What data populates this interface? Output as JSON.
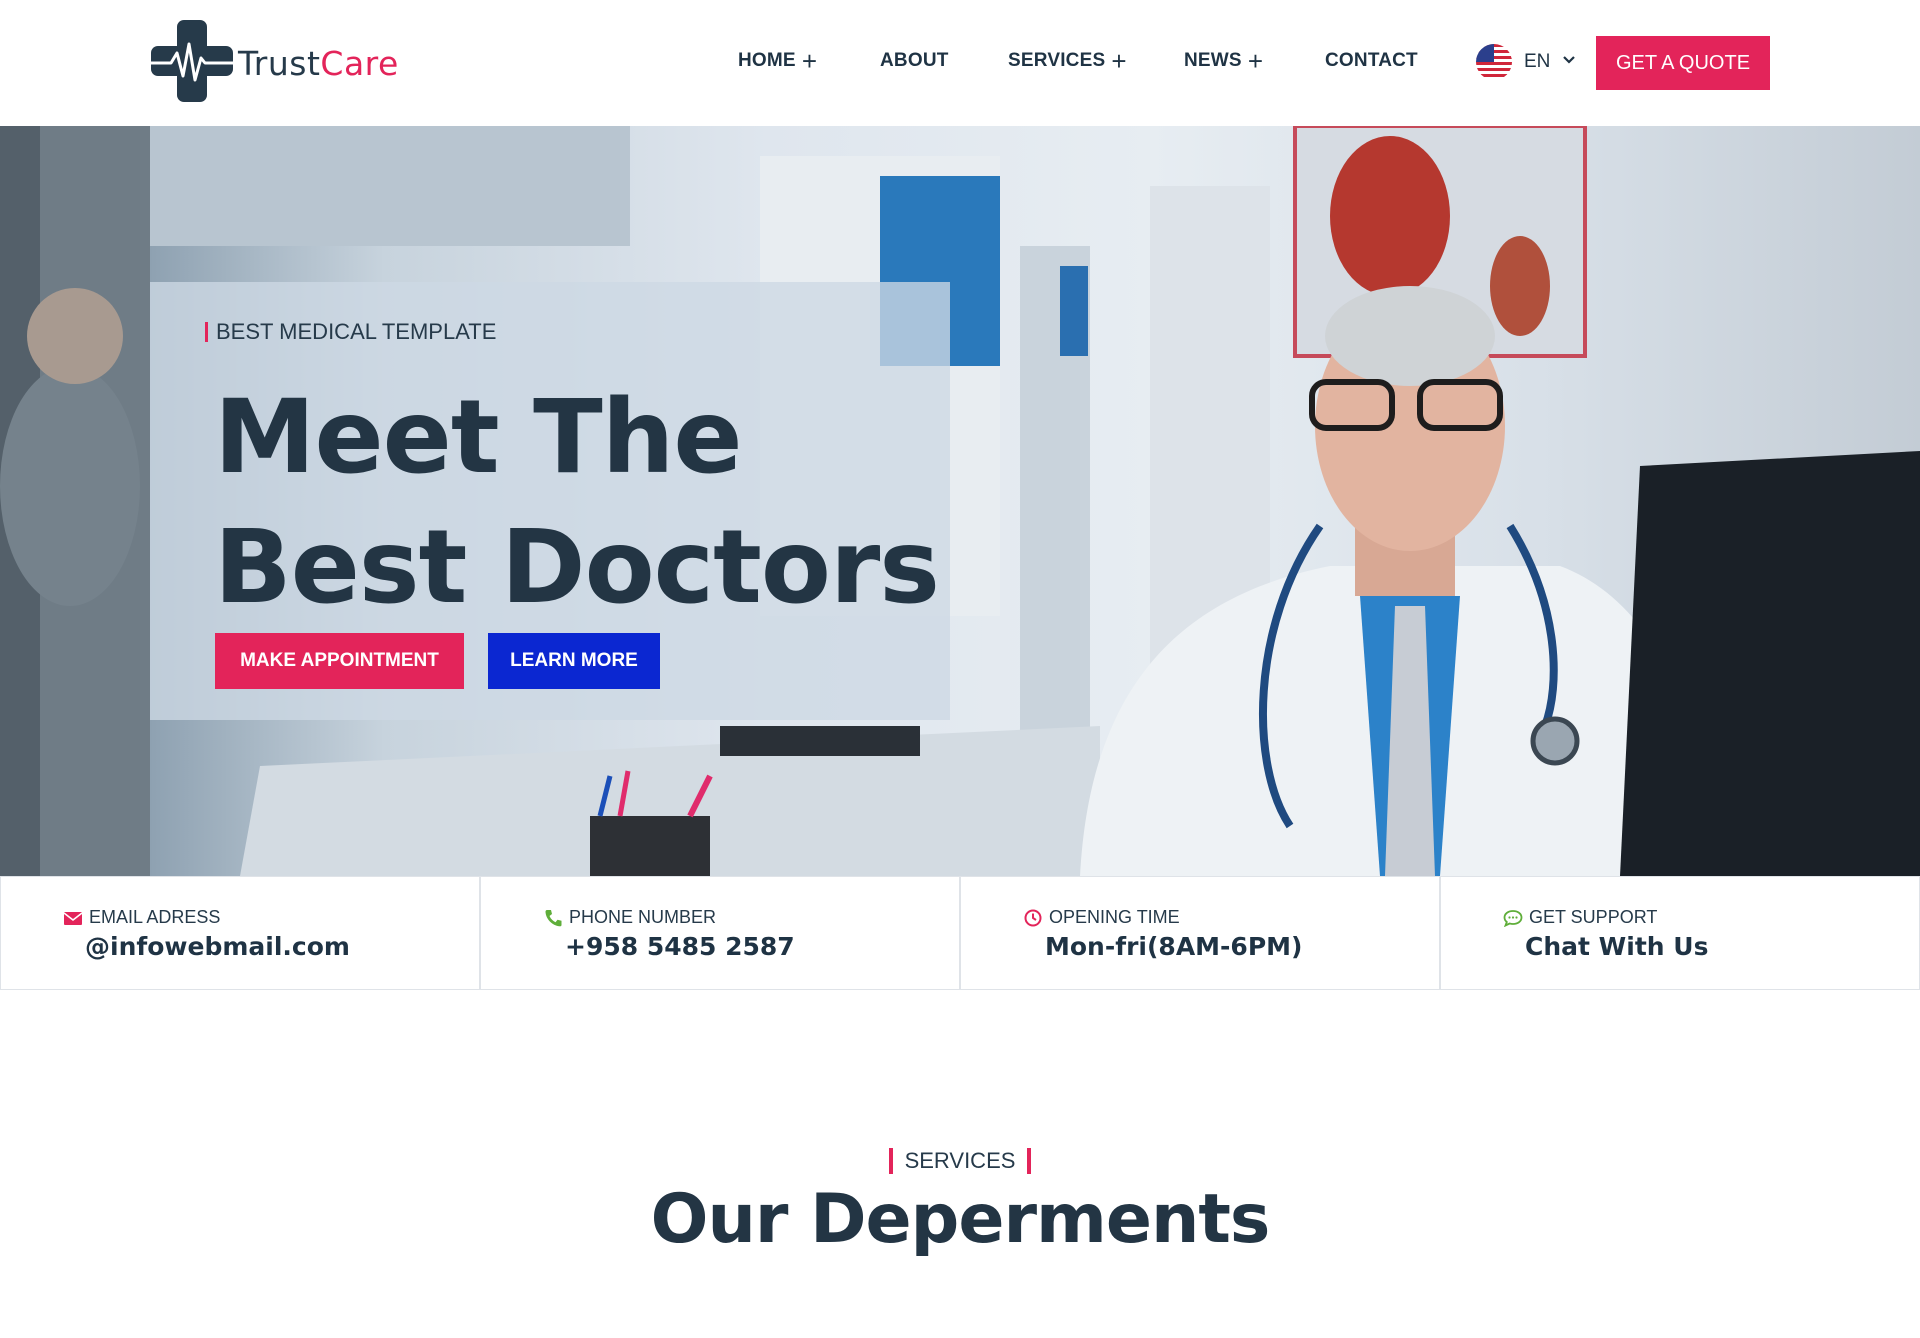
{
  "brand": {
    "name_part1": "Trust",
    "name_part2": "Care",
    "logo_icon": "medical-cross-heartbeat-icon"
  },
  "nav": {
    "items": [
      {
        "label": "HOME",
        "has_submenu": true
      },
      {
        "label": "ABOUT",
        "has_submenu": false
      },
      {
        "label": "SERVICES",
        "has_submenu": true
      },
      {
        "label": "NEWS",
        "has_submenu": true
      },
      {
        "label": "CONTACT",
        "has_submenu": false
      }
    ],
    "plus_glyph": "+"
  },
  "language": {
    "code": "EN",
    "flag_icon": "us-flag-icon"
  },
  "header_cta": {
    "label": "GET A QUOTE"
  },
  "hero": {
    "eyebrow": "BEST MEDICAL TEMPLATE",
    "title_line1": "Meet The",
    "title_line2": "Best Doctors",
    "primary_button": "MAKE APPOINTMENT",
    "secondary_button": "LEARN MORE"
  },
  "info_strip": [
    {
      "icon": "envelope-icon",
      "label": "EMAIL ADRESS",
      "value": "@infowebmail.com"
    },
    {
      "icon": "phone-icon",
      "label": "PHONE NUMBER",
      "value": "+958 5485 2587"
    },
    {
      "icon": "clock-icon",
      "label": "OPENING TIME",
      "value": "Mon-fri(8AM-6PM)"
    },
    {
      "icon": "chat-icon",
      "label": "GET SUPPORT",
      "value": "Chat With Us"
    }
  ],
  "services": {
    "eyebrow": "SERVICES",
    "title": "Our Deperments"
  },
  "colors": {
    "accent": "#e3245a",
    "dark": "#233544",
    "blue_button": "#0b27d1",
    "icon_green": "#5fae3a"
  }
}
